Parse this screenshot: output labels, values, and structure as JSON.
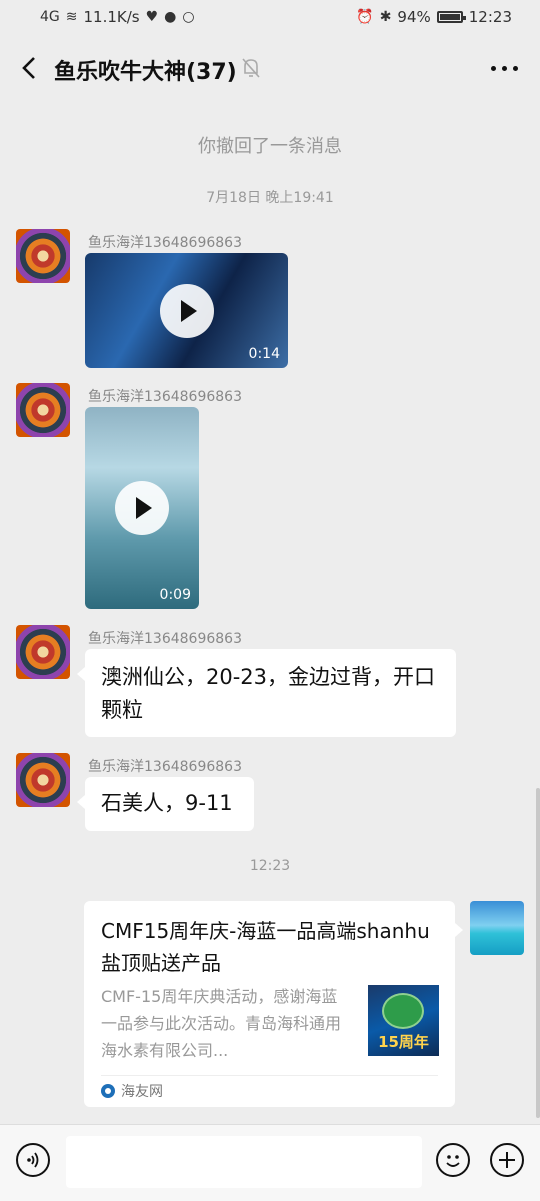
{
  "status": {
    "network": "4G",
    "speed": "11.1K/s",
    "battery": "94%",
    "time": "12:23"
  },
  "header": {
    "title": "鱼乐吹牛大神(37)",
    "back_icon": "back-arrow-icon",
    "mute_icon": "muted-bell-icon",
    "more_icon": "more-icon"
  },
  "messages": {
    "recall": "你撤回了一条消息",
    "time1": "7月18日 晚上19:41",
    "msg1": {
      "sender": "鱼乐海洋13648696863",
      "duration": "0:14"
    },
    "msg2": {
      "sender": "鱼乐海洋13648696863",
      "duration": "0:09"
    },
    "msg3": {
      "sender": "鱼乐海洋13648696863",
      "text": "澳洲仙公，20-23，金边过背，开口颗粒"
    },
    "msg4": {
      "sender": "鱼乐海洋13648696863",
      "text": "石美人，9-11"
    },
    "time2": "12:23",
    "card": {
      "title": "CMF15周年庆-海蓝一品高端shanhu盐顶贴送产品",
      "desc": "CMF-15周年庆典活动，感谢海蓝一品参与此次活动。青岛海科通用海水素有限公司...",
      "thumb_text": "15周年",
      "source": "海友网"
    }
  },
  "colors": {
    "background": "#ededed",
    "bubble": "#ffffff",
    "meta_text": "#999999"
  }
}
